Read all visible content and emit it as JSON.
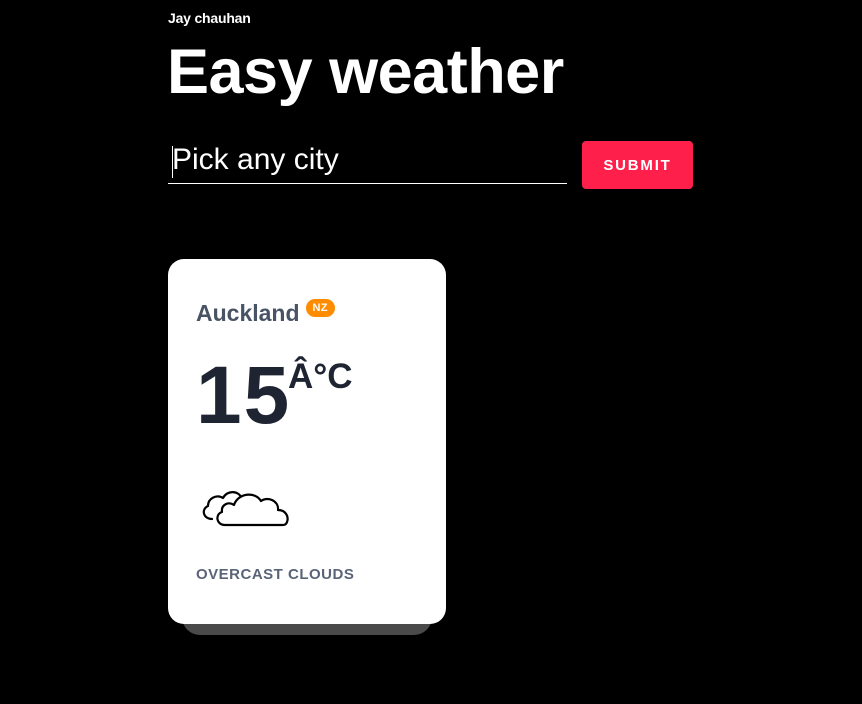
{
  "header": {
    "author": "Jay chauhan",
    "title": "Easy weather"
  },
  "search": {
    "placeholder": "Pick any city",
    "value": "",
    "submit_label": "SUBMIT"
  },
  "card": {
    "city": "Auckland",
    "country": "NZ",
    "temperature": "15",
    "unit": "Â°C",
    "icon": "overcast-clouds-icon",
    "description": "OVERCAST CLOUDS"
  },
  "colors": {
    "background": "#000000",
    "accent": "#ff1f4b",
    "badge": "#ff8c00",
    "card": "#ffffff",
    "city_text": "#495366",
    "temp_text": "#1f2433"
  }
}
